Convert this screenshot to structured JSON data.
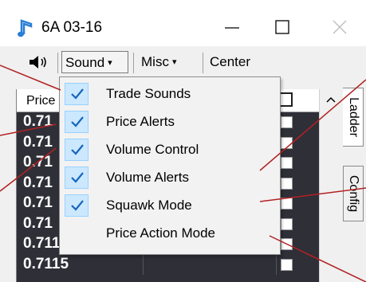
{
  "window": {
    "title": "6A 03-16",
    "minimize_glyph": "minimize-icon",
    "maximize_glyph": "maximize-icon",
    "close_glyph": "close-icon"
  },
  "toolbar": {
    "sound_label": "Sound",
    "misc_label": "Misc",
    "center_label": "Center",
    "caret": "▾"
  },
  "grid": {
    "header_price": "Price",
    "rows": [
      "0.71",
      "0.71",
      "0.71",
      "0.71",
      "0.71",
      "0.71",
      "0.7116",
      "0.7115"
    ]
  },
  "side_tabs": {
    "ladder": "Ladder",
    "config": "Config"
  },
  "sound_menu": {
    "items": [
      {
        "label": "Trade Sounds",
        "checked": true
      },
      {
        "label": "Price Alerts",
        "checked": true
      },
      {
        "label": "Volume Control",
        "checked": true
      },
      {
        "label": "Volume Alerts",
        "checked": true
      },
      {
        "label": "Squawk Mode",
        "checked": true
      },
      {
        "label": "Price Action Mode",
        "checked": false
      }
    ]
  },
  "colors": {
    "grid_bg": "#2f2f38",
    "menu_highlight": "#cce8ff",
    "check_color": "#1565c0",
    "annotation_line": "#b22222",
    "app_icon": "#2a7fd4"
  }
}
